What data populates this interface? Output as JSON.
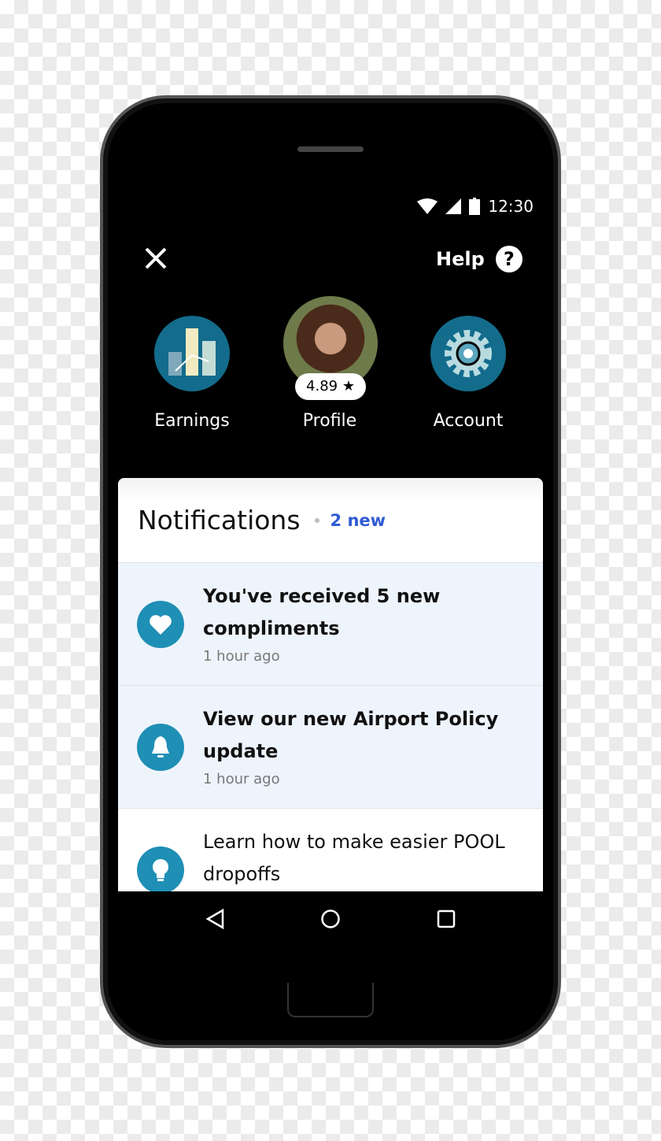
{
  "status": {
    "time": "12:30"
  },
  "header": {
    "help_label": "Help"
  },
  "shortcuts": [
    {
      "label": "Earnings",
      "icon": "earnings-chart-icon"
    },
    {
      "label": "Profile",
      "rating": "4.89 ★"
    },
    {
      "label": "Account",
      "icon": "gear-icon"
    }
  ],
  "notifications": {
    "title": "Notifications",
    "new_count": "2 new",
    "items": [
      {
        "title": "You've received 5 new compliments",
        "time": "1 hour ago",
        "icon": "heart-icon",
        "unread": true
      },
      {
        "title": "View our new Airport Policy update",
        "time": "1 hour ago",
        "icon": "bell-icon",
        "unread": true
      },
      {
        "title": "Learn how to make easier POOL dropoffs",
        "icon": "lightbulb-icon",
        "unread": false
      }
    ]
  },
  "colors": {
    "accent": "#1f8fb5",
    "link": "#2f5bd3",
    "unread_bg": "#eef4fc"
  }
}
